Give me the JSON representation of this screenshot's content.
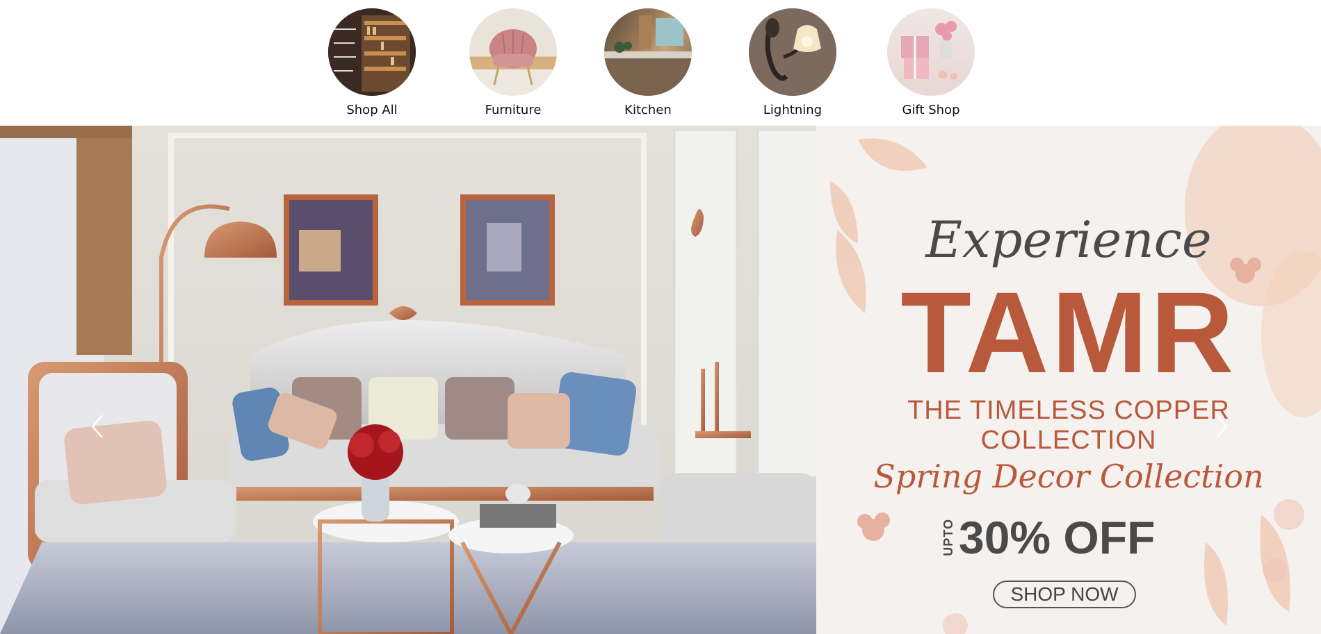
{
  "categories": [
    {
      "label": "Shop All",
      "image": "bookshelf-store-photo"
    },
    {
      "label": "Furniture",
      "image": "pink-velvet-chair-photo"
    },
    {
      "label": "Kitchen",
      "image": "kitchen-interior-photo"
    },
    {
      "label": "Lightning",
      "image": "wall-sconce-lamp-photo"
    },
    {
      "label": "Gift Shop",
      "image": "gift-boxes-photo"
    }
  ],
  "banner": {
    "image": "living-room-copper-furniture-photo",
    "promo": {
      "script_title": "Experience",
      "brand": "TAMR",
      "tagline_line1": "THE TIMELESS COPPER",
      "tagline_line2": "COLLECTION",
      "subtitle": "Spring Decor Collection",
      "upto": "UPTO",
      "discount": "30% OFF",
      "cta": "SHOP NOW"
    },
    "prev_icon": "chevron-left-icon",
    "next_icon": "chevron-right-icon"
  },
  "colors": {
    "accent": "#b9593b",
    "text_dark": "#4a4a4a",
    "copper": "#c07a55"
  }
}
